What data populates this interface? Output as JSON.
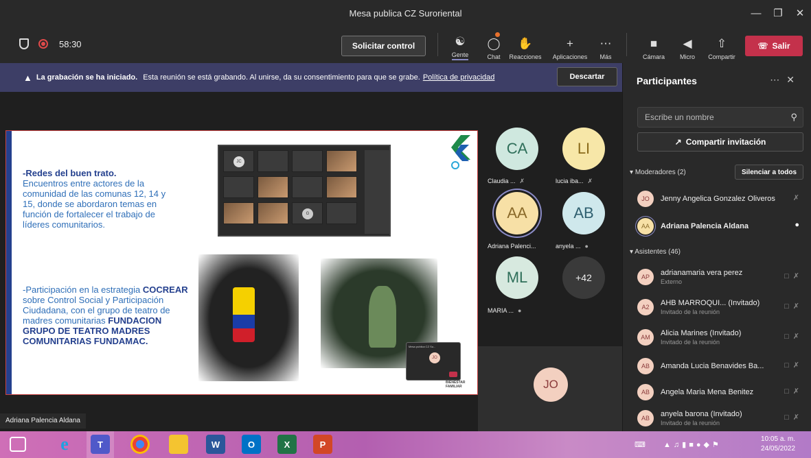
{
  "window": {
    "title": "Mesa publica CZ Suroriental"
  },
  "meeting_bar": {
    "timer": "58:30",
    "request_control_label": "Solicitar control",
    "tools": [
      {
        "label": "Gente",
        "icon": "people-icon"
      },
      {
        "label": "Chat",
        "icon": "chat-icon"
      },
      {
        "label": "Reacciones",
        "icon": "reactions-icon"
      },
      {
        "label": "Aplicaciones",
        "icon": "plus-icon"
      },
      {
        "label": "Más",
        "icon": "more-icon"
      },
      {
        "label": "Cámara",
        "icon": "camera-off-icon"
      },
      {
        "label": "Micro",
        "icon": "mic-off-icon"
      },
      {
        "label": "Compartir",
        "icon": "share-icon"
      }
    ],
    "leave_label": "Salir"
  },
  "banner": {
    "bold_text": "La grabación se ha iniciado.",
    "text": "Esta reunión se está grabando. Al unirse, da su consentimiento para que se grabe.",
    "link": "Política de privacidad",
    "dismiss_label": "Descartar"
  },
  "slide": {
    "block1_title": "-Redes del buen trato.",
    "block1_text": "Encuentros entre actores de la comunidad de las comunas 12, 14 y 15, donde se abordaron temas en función de fortalecer el trabajo de líderes comunitarios.",
    "block2_prefix": "-Participación en la estrategia",
    "block2_bold1": "COCREAR",
    "block2_mid": "sobre Control Social y Participación Ciudadana, con el grupo de teatro de madres comunitarias",
    "block2_bold2": "FUNDACION GRUPO DE TEATRO MADRES COMUNITARIAS FUNDAMAC.",
    "mini_title": "Mesa publica CZ Su...",
    "mini_avatar": "JO",
    "shot_avatars": [
      "JC",
      "G"
    ],
    "footer_logo": "BIENESTAR FAMILIAR"
  },
  "grid": {
    "tiles": [
      {
        "initials": "CA",
        "name": "Claudia ...",
        "color": "#cfe8df",
        "text_color": "#2f6f5a"
      },
      {
        "initials": "LI",
        "name": "lucia iba...",
        "color": "#f7e7a8",
        "text_color": "#8a6a1a"
      },
      {
        "initials": "AA",
        "name": "Adriana Palenci...",
        "color": "#f7e0a6",
        "text_color": "#8a6a2a"
      },
      {
        "initials": "AB",
        "name": "anyela ...",
        "color": "#cfe8ec",
        "text_color": "#2f5f6f"
      },
      {
        "initials": "ML",
        "name": "MARIA ...",
        "color": "#d7e9df",
        "text_color": "#2f6f5a"
      }
    ],
    "more_label": "+42",
    "self_initials": "JO"
  },
  "panel": {
    "title": "Participantes",
    "search_placeholder": "Escribe un nombre",
    "share_label": "Compartir invitación",
    "moderators_label": "Moderadores (2)",
    "mute_all_label": "Silenciar a todos",
    "attendees_label": "Asistentes (46)",
    "moderators": [
      {
        "initials": "JO",
        "name": "Jenny Angelica Gonzalez Oliveros",
        "sub": ""
      },
      {
        "initials": "AA",
        "name": "Adriana Palencia Aldana",
        "sub": ""
      }
    ],
    "attendees": [
      {
        "initials": "AP",
        "name": "adrianamaria vera perez",
        "sub": "Externo"
      },
      {
        "initials": "A2",
        "name": "AHB MARROQUI... (Invitado)",
        "sub": "Invitado de la reunión"
      },
      {
        "initials": "AM",
        "name": "Alicia Marines (Invitado)",
        "sub": "Invitado de la reunión"
      },
      {
        "initials": "AB",
        "name": "Amanda Lucia Benavides Ba...",
        "sub": ""
      },
      {
        "initials": "AB",
        "name": "Angela Maria Mena Benitez",
        "sub": ""
      },
      {
        "initials": "AB",
        "name": "anyela barona (Invitado)",
        "sub": "Invitado de la reunión"
      }
    ]
  },
  "active_speaker_label": "Adriana Palencia Aldana",
  "taskbar": {
    "apps": [
      "T",
      "W",
      "O",
      "X",
      "P"
    ],
    "time": "10:05 a. m.",
    "date": "24/05/2022"
  },
  "colors": {
    "accent": "#8b8cc7",
    "leave": "#c4314b",
    "banner": "#3d3e66"
  }
}
